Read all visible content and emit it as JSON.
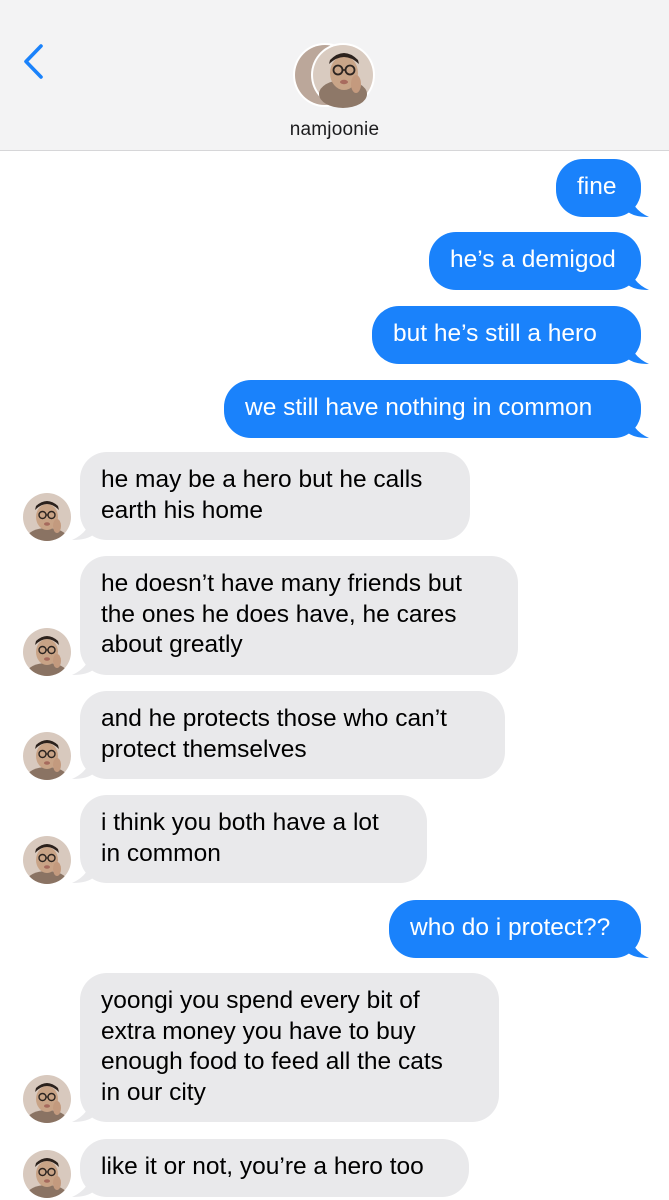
{
  "header": {
    "contact_name": "namjoonie",
    "back_icon": "chevron-left-icon",
    "accent_color": "#1a82fb"
  },
  "messages": [
    {
      "from": "me",
      "lines": [
        "fine"
      ]
    },
    {
      "from": "me",
      "lines": [
        "he’s a demigod"
      ]
    },
    {
      "from": "me",
      "lines": [
        "but he’s still a hero"
      ]
    },
    {
      "from": "me",
      "lines": [
        "we still have nothing in common"
      ]
    },
    {
      "from": "them",
      "lines": [
        "he may be a hero but he calls",
        "earth his home"
      ]
    },
    {
      "from": "them",
      "lines": [
        "he doesn’t have many friends but",
        "the ones he does have, he cares",
        "about greatly"
      ]
    },
    {
      "from": "them",
      "lines": [
        "and he protects those who can’t",
        "protect themselves"
      ]
    },
    {
      "from": "them",
      "lines": [
        "i think you both have a lot",
        "in common"
      ]
    },
    {
      "from": "me",
      "lines": [
        "who do i protect??"
      ]
    },
    {
      "from": "them",
      "lines": [
        "yoongi you spend every bit of",
        "extra money you have to buy",
        "enough food to feed all the cats",
        "in our city"
      ]
    },
    {
      "from": "them",
      "lines": [
        "like it or not, you’re a hero too"
      ]
    }
  ]
}
